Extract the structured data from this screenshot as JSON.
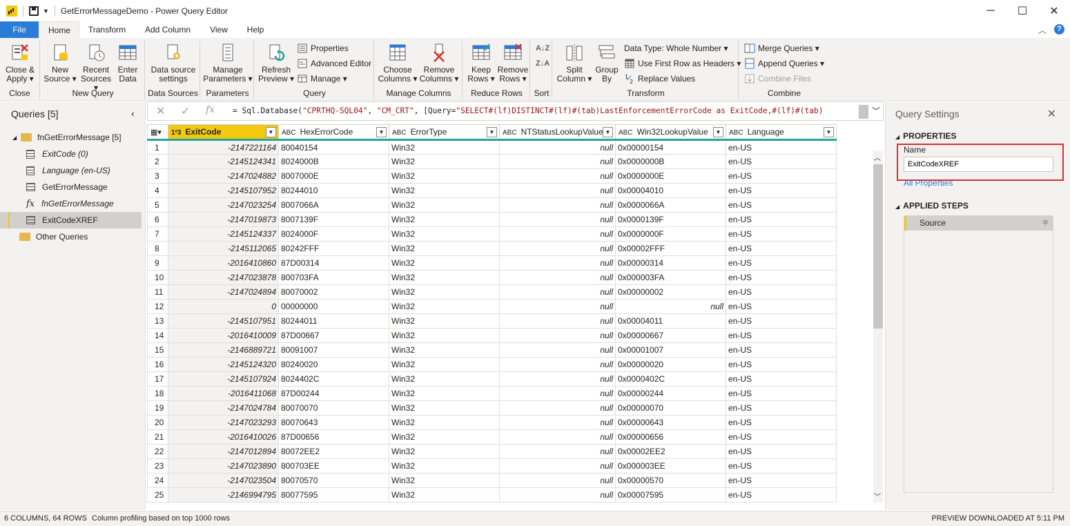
{
  "titlebar": {
    "title": "GetErrorMessageDemo - Power Query Editor",
    "app_icon": "power-bi-icon",
    "minimize": "─",
    "maximize": "☐",
    "close": "✕"
  },
  "tabs": [
    "File",
    "Home",
    "Transform",
    "Add Column",
    "View",
    "Help"
  ],
  "tabs_active": "Home",
  "accent": "#f2c811",
  "file_color": "#2b7bd8",
  "ribbon": {
    "close_group": {
      "label": "Close",
      "close_apply": [
        "Close &",
        "Apply ▾"
      ]
    },
    "new_query_group": {
      "label": "New Query",
      "new_source": [
        "New",
        "Source ▾"
      ],
      "recent_sources": [
        "Recent",
        "Sources ▾"
      ],
      "enter_data": [
        "Enter",
        "Data"
      ]
    },
    "data_sources_group": {
      "label": "Data Sources",
      "settings": [
        "Data source",
        "settings"
      ]
    },
    "parameters_group": {
      "label": "Parameters",
      "manage": [
        "Manage",
        "Parameters ▾"
      ]
    },
    "query_group": {
      "label": "Query",
      "refresh": [
        "Refresh",
        "Preview ▾"
      ],
      "properties": "Properties",
      "advanced_editor": "Advanced Editor",
      "manage": "Manage ▾"
    },
    "manage_columns_group": {
      "label": "Manage Columns",
      "choose": [
        "Choose",
        "Columns ▾"
      ],
      "remove": [
        "Remove",
        "Columns ▾"
      ]
    },
    "reduce_rows_group": {
      "label": "Reduce Rows",
      "keep": [
        "Keep",
        "Rows ▾"
      ],
      "remove": [
        "Remove",
        "Rows ▾"
      ]
    },
    "sort_group": {
      "label": "Sort"
    },
    "transform_group": {
      "label": "Transform",
      "split": [
        "Split",
        "Column ▾"
      ],
      "group_by": [
        "Group",
        "By"
      ],
      "data_type": "Data Type: Whole Number ▾",
      "first_row": "Use First Row as Headers ▾",
      "replace": "Replace Values"
    },
    "combine_group": {
      "label": "Combine",
      "merge": "Merge Queries ▾",
      "append": "Append Queries ▾",
      "combine_files": "Combine Files"
    }
  },
  "queries_pane": {
    "title": "Queries [5]",
    "items": [
      {
        "label": "fnGetErrorMessage [5]",
        "type": "folder"
      },
      {
        "label": "ExitCode (0)",
        "type": "param"
      },
      {
        "label": "Language (en-US)",
        "type": "param"
      },
      {
        "label": "GetErrorMessage",
        "type": "table"
      },
      {
        "label": "fnGetErrorMessage",
        "type": "fx"
      },
      {
        "label": "ExitCodeXREF",
        "type": "table"
      },
      {
        "label": "Other Queries",
        "type": "folder"
      }
    ]
  },
  "formula": {
    "prefix": "= Sql.Database(",
    "s1": "\"CPRTHQ-SQL04\"",
    "sep": ", ",
    "s2": "\"CM_CRT\"",
    "mid": ", [Query=",
    "s3": "\"SELECT#(lf)DISTINCT#(lf)#(tab)LastEnforcementErrorCode as ExitCode,#(lf)#(tab)"
  },
  "grid": {
    "columns": [
      {
        "type": "1²3",
        "name": "ExitCode"
      },
      {
        "type": "ABC",
        "name": "HexErrorCode"
      },
      {
        "type": "ABC",
        "name": "ErrorType"
      },
      {
        "type": "ABC",
        "name": "NTStatusLookupValue"
      },
      {
        "type": "ABC",
        "name": "Win32LookupValue"
      },
      {
        "type": "ABC",
        "name": "Language"
      }
    ],
    "rows": [
      [
        "-2147221164",
        "80040154",
        "Win32",
        "null",
        "0x00000154",
        "en-US"
      ],
      [
        "-2145124341",
        "8024000B",
        "Win32",
        "null",
        "0x0000000B",
        "en-US"
      ],
      [
        "-2147024882",
        "8007000E",
        "Win32",
        "null",
        "0x0000000E",
        "en-US"
      ],
      [
        "-2145107952",
        "80244010",
        "Win32",
        "null",
        "0x00004010",
        "en-US"
      ],
      [
        "-2147023254",
        "8007066A",
        "Win32",
        "null",
        "0x0000066A",
        "en-US"
      ],
      [
        "-2147019873",
        "8007139F",
        "Win32",
        "null",
        "0x0000139F",
        "en-US"
      ],
      [
        "-2145124337",
        "8024000F",
        "Win32",
        "null",
        "0x0000000F",
        "en-US"
      ],
      [
        "-2145112065",
        "80242FFF",
        "Win32",
        "null",
        "0x00002FFF",
        "en-US"
      ],
      [
        "-2016410860",
        "87D00314",
        "Win32",
        "null",
        "0x00000314",
        "en-US"
      ],
      [
        "-2147023878",
        "800703FA",
        "Win32",
        "null",
        "0x000003FA",
        "en-US"
      ],
      [
        "-2147024894",
        "80070002",
        "Win32",
        "null",
        "0x00000002",
        "en-US"
      ],
      [
        "0",
        "00000000",
        "Win32",
        "null",
        "null",
        "en-US"
      ],
      [
        "-2145107951",
        "80244011",
        "Win32",
        "null",
        "0x00004011",
        "en-US"
      ],
      [
        "-2016410009",
        "87D00667",
        "Win32",
        "null",
        "0x00000667",
        "en-US"
      ],
      [
        "-2146889721",
        "80091007",
        "Win32",
        "null",
        "0x00001007",
        "en-US"
      ],
      [
        "-2145124320",
        "80240020",
        "Win32",
        "null",
        "0x00000020",
        "en-US"
      ],
      [
        "-2145107924",
        "8024402C",
        "Win32",
        "null",
        "0x0000402C",
        "en-US"
      ],
      [
        "-2016411068",
        "87D00244",
        "Win32",
        "null",
        "0x00000244",
        "en-US"
      ],
      [
        "-2147024784",
        "80070070",
        "Win32",
        "null",
        "0x00000070",
        "en-US"
      ],
      [
        "-2147023293",
        "80070643",
        "Win32",
        "null",
        "0x00000643",
        "en-US"
      ],
      [
        "-2016410026",
        "87D00656",
        "Win32",
        "null",
        "0x00000656",
        "en-US"
      ],
      [
        "-2147012894",
        "80072EE2",
        "Win32",
        "null",
        "0x00002EE2",
        "en-US"
      ],
      [
        "-2147023890",
        "800703EE",
        "Win32",
        "null",
        "0x000003EE",
        "en-US"
      ],
      [
        "-2147023504",
        "80070570",
        "Win32",
        "null",
        "0x00000570",
        "en-US"
      ],
      [
        "-2146994795",
        "80077595",
        "Win32",
        "null",
        "0x00007595",
        "en-US"
      ]
    ]
  },
  "query_settings": {
    "title": "Query Settings",
    "properties_header": "PROPERTIES",
    "name_label": "Name",
    "name_value": "ExitCodeXREF",
    "all_properties": "All Properties",
    "steps_header": "APPLIED STEPS",
    "steps": [
      "Source"
    ]
  },
  "status": {
    "left": "6 COLUMNS, 64 ROWS",
    "profiling": "Column profiling based on top 1000 rows",
    "right": "PREVIEW DOWNLOADED AT 5:11 PM"
  }
}
